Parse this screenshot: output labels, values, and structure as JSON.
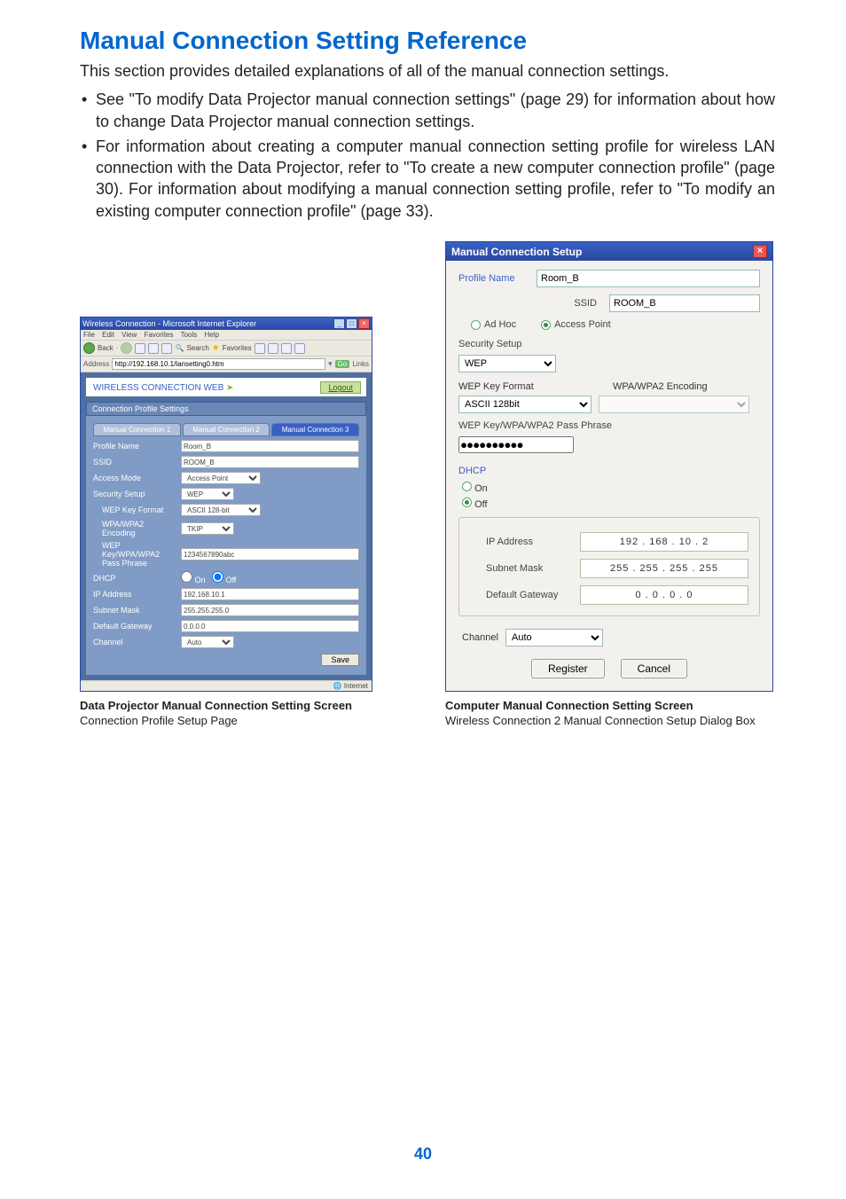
{
  "page_number": "40",
  "heading": "Manual Connection Setting Reference",
  "intro": "This section provides detailed explanations of all of the manual connection settings.",
  "bullets": [
    "See \"To modify Data Projector manual connection settings\" (page 29) for information about how to change Data Projector manual connection settings.",
    "For information about creating a computer manual connection setting profile for wireless LAN connection with the Data Projector, refer to \"To create a new computer connection profile\" (page 30). For information about modifying a manual connection setting profile, refer to \"To modify an existing computer connection profile\" (page 33)."
  ],
  "left_caption_bold": "Data Projector Manual Connection Setting Screen",
  "left_caption_plain": "Connection Profile Setup Page",
  "right_caption_bold": "Computer Manual Connection Setting Screen",
  "right_caption_plain": "Wireless Connection 2 Manual Connection Setup Dialog Box",
  "ie": {
    "title": "Wireless Connection - Microsoft Internet Explorer",
    "menu": [
      "File",
      "Edit",
      "View",
      "Favorites",
      "Tools",
      "Help"
    ],
    "toolbar": {
      "back": "Back",
      "search": "Search",
      "favorites": "Favorites"
    },
    "address_label": "Address",
    "address_value": "http://192.168.10.1/lansetting0.htm",
    "go": "Go",
    "links": "Links",
    "wc_header": "WIRELESS CONNECTION WEB",
    "logout": "Logout",
    "section_header": "Connection Profile Settings",
    "tabs": [
      "Manual Connection 1",
      "Manual Connection 2",
      "Manual Connection 3"
    ],
    "form": {
      "profile_name_l": "Profile Name",
      "profile_name_v": "Room_B",
      "ssid_l": "SSID",
      "ssid_v": "ROOM_B",
      "access_mode_l": "Access Mode",
      "access_mode_v": "Access Point",
      "security_l": "Security Setup",
      "security_v": "WEP",
      "wepkey_l": "WEP Key Format",
      "wepkey_v": "ASCII 128-bit",
      "enc_l": "WPA/WPA2 Encoding",
      "enc_v": "TKIP",
      "pass_l": "WEP Key/WPA/WPA2 Pass Phrase",
      "pass_v": "1234567890abc",
      "dhcp_l": "DHCP",
      "dhcp_on": "On",
      "dhcp_off": "Off",
      "ip_l": "IP Address",
      "ip_v": "192.168.10.1",
      "subnet_l": "Subnet Mask",
      "subnet_v": "255.255.255.0",
      "gw_l": "Default Gateway",
      "gw_v": "0.0.0.0",
      "channel_l": "Channel",
      "channel_v": "Auto",
      "save": "Save"
    },
    "status_right": "Internet"
  },
  "wiz": {
    "title": "Manual Connection Setup",
    "profile_name_l": "Profile Name",
    "profile_name_v": "Room_B",
    "ssid_l": "SSID",
    "ssid_v": "ROOM_B",
    "adhoc": "Ad Hoc",
    "accesspoint": "Access Point",
    "security_header": "Security Setup",
    "security_v": "WEP",
    "wepkey_l": "WEP Key Format",
    "wepkey_v": "ASCII 128bit",
    "enc_l": "WPA/WPA2 Encoding",
    "enc_v": "",
    "pass_l": "WEP Key/WPA/WPA2 Pass Phrase",
    "pass_v": "●●●●●●●●●●",
    "dhcp_l": "DHCP",
    "dhcp_on": "On",
    "dhcp_off": "Off",
    "ip_l": "IP Address",
    "ip_v": "192 . 168 . 10 .  2",
    "subnet_l": "Subnet Mask",
    "subnet_v": "255 . 255 . 255 . 255",
    "gw_l": "Default Gateway",
    "gw_v": "0  .  0  .  0  .  0",
    "channel_l": "Channel",
    "channel_v": "Auto",
    "register": "Register",
    "cancel": "Cancel"
  }
}
